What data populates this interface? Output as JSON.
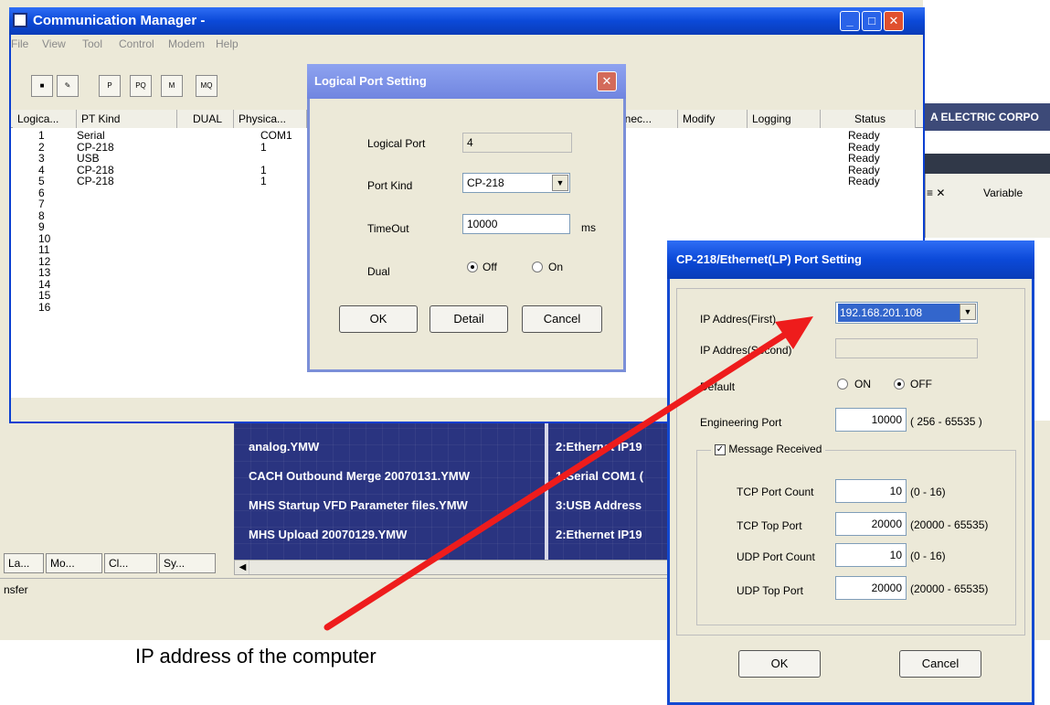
{
  "background": {
    "company": "A ELECTRIC CORPO",
    "variable_label": "Variable",
    "close_x": "≡ ✕",
    "blue_list_left": [
      "analog.YMW",
      "CACH Outbound Merge 20070131.YMW",
      "MHS Startup VFD Parameter files.YMW",
      "MHS Upload 20070129.YMW"
    ],
    "blue_list_right": [
      "2:Ethernet IP19",
      "1:Serial COM1 (",
      "3:USB Address",
      "2:Ethernet IP19"
    ],
    "tabs": [
      "La...",
      "Mo...",
      "Cl...",
      "Sy..."
    ],
    "status_text": "nsfer"
  },
  "comm_manager": {
    "title": "Communication Manager -",
    "menu": [
      "File",
      "View",
      "Tool",
      "Control",
      "Modem",
      "Help"
    ],
    "toolbar": [
      "P",
      "PQ",
      "M",
      "MQ"
    ],
    "columns": [
      "Logica...",
      "PT Kind",
      "DUAL",
      "Physica...",
      "nnec...",
      "Modify",
      "Logging",
      "Status"
    ],
    "rows": [
      {
        "no": "1",
        "kind": "Serial",
        "phys": "COM1",
        "status": "Ready"
      },
      {
        "no": "2",
        "kind": "CP-218",
        "phys": "1",
        "status": "Ready"
      },
      {
        "no": "3",
        "kind": "USB",
        "phys": "",
        "status": "Ready"
      },
      {
        "no": "4",
        "kind": "CP-218",
        "phys": "1",
        "status": "Ready"
      },
      {
        "no": "5",
        "kind": "CP-218",
        "phys": "1",
        "status": "Ready"
      },
      {
        "no": "6",
        "kind": "",
        "phys": "",
        "status": ""
      },
      {
        "no": "7",
        "kind": "",
        "phys": "",
        "status": ""
      },
      {
        "no": "8",
        "kind": "",
        "phys": "",
        "status": ""
      },
      {
        "no": "9",
        "kind": "",
        "phys": "",
        "status": ""
      },
      {
        "no": "10",
        "kind": "",
        "phys": "",
        "status": ""
      },
      {
        "no": "11",
        "kind": "",
        "phys": "",
        "status": ""
      },
      {
        "no": "12",
        "kind": "",
        "phys": "",
        "status": ""
      },
      {
        "no": "13",
        "kind": "",
        "phys": "",
        "status": ""
      },
      {
        "no": "14",
        "kind": "",
        "phys": "",
        "status": ""
      },
      {
        "no": "15",
        "kind": "",
        "phys": "",
        "status": ""
      },
      {
        "no": "16",
        "kind": "",
        "phys": "",
        "status": ""
      }
    ]
  },
  "logical_port": {
    "title": "Logical Port Setting",
    "logical_port_label": "Logical Port",
    "logical_port_value": "4",
    "port_kind_label": "Port Kind",
    "port_kind_value": "CP-218",
    "timeout_label": "TimeOut",
    "timeout_value": "10000",
    "timeout_unit": "ms",
    "dual_label": "Dual",
    "dual_off": "Off",
    "dual_on": "On",
    "ok": "OK",
    "detail": "Detail",
    "cancel": "Cancel"
  },
  "cp218": {
    "title": "CP-218/Ethernet(LP) Port Setting",
    "ip_first_label": "IP Addres(First)",
    "ip_first_value": "192.168.201.108",
    "ip_second_label": "IP Addres(Second)",
    "default_label": "Default",
    "on_label": "ON",
    "off_label": "OFF",
    "eng_port_label": "Engineering Port",
    "eng_port_value": "10000",
    "eng_port_range": "( 256 - 65535 )",
    "message_received": "Message Received",
    "tcp_count_label": "TCP Port Count",
    "tcp_count_value": "10",
    "tcp_count_range": "(0 - 16)",
    "tcp_top_label": "TCP Top Port",
    "tcp_top_value": "20000",
    "tcp_top_range": "(20000 - 65535)",
    "udp_count_label": "UDP Port Count",
    "udp_count_value": "10",
    "udp_count_range": "(0 - 16)",
    "udp_top_label": "UDP Top Port",
    "udp_top_value": "20000",
    "udp_top_range": "(20000 - 65535)",
    "ok": "OK",
    "cancel": "Cancel"
  },
  "annotation": {
    "text": "IP address of the computer",
    "arrow_color": "#ee1c1c"
  }
}
